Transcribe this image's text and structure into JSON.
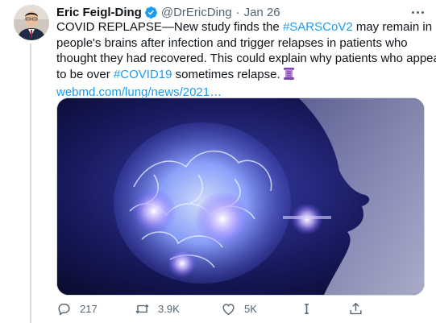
{
  "tweet": {
    "author_name": "Eric Feigl-Ding",
    "handle": "@DrEricDing",
    "separator": "·",
    "date": "Jan 26",
    "text": {
      "line1_a": "COVID REPLAPSE—New study finds the ",
      "line1_hashtag": "#SARSCoV2",
      "line1_b": " may remain in",
      "line2": "people's brains after infection and trigger relapses in patients who",
      "line3": "thought they had recovered. This could explain why patients who appear",
      "line4_a": "to be over ",
      "line4_hashtag": "#COVID19",
      "line4_b": " sometimes relapse.",
      "link": "webmd.com/lung/news/2021…"
    },
    "actions": {
      "reply_count": "217",
      "retweet_count": "3.9K",
      "like_count": "5K"
    }
  },
  "colors": {
    "accent": "#1d9bf0",
    "secondary_text": "#536471",
    "primary_text": "#0f1419",
    "thread_line": "#cfd9de"
  },
  "icons": [
    "verified-badge-icon",
    "more-icon",
    "scroll-emoji-icon",
    "reply-icon",
    "retweet-icon",
    "like-icon",
    "stat-icon",
    "share-icon"
  ]
}
